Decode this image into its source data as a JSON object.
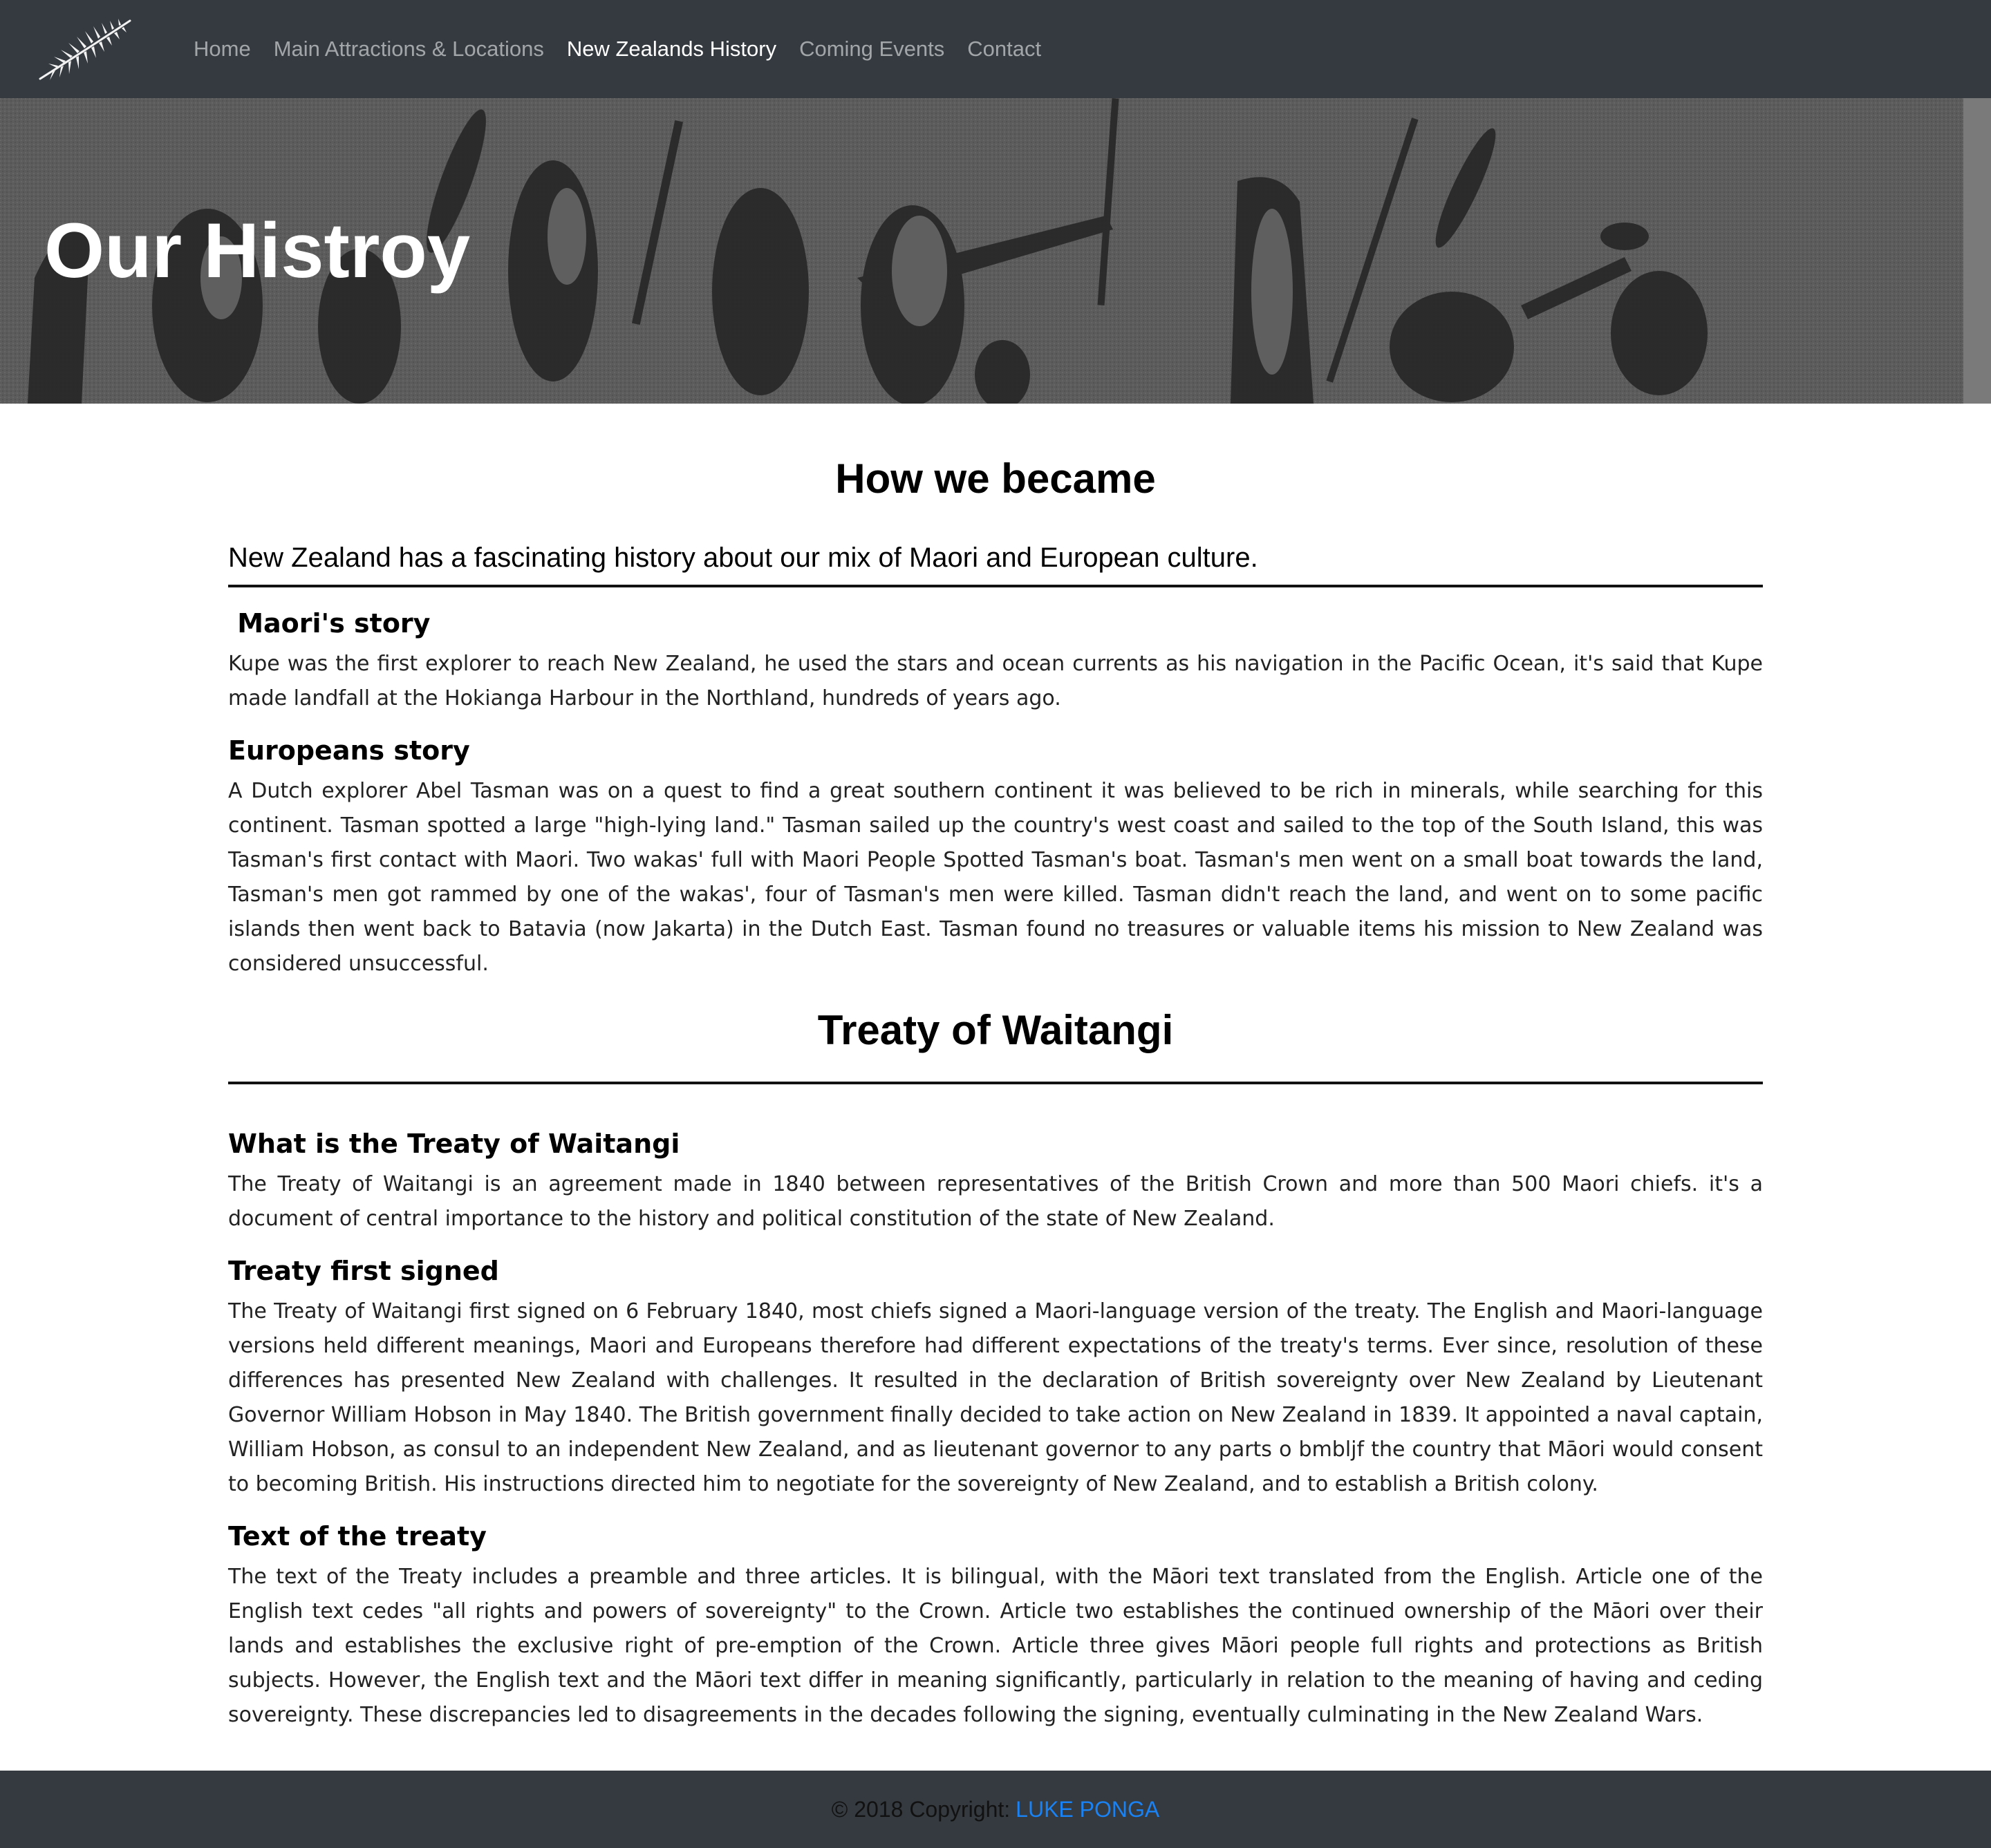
{
  "nav": {
    "brand_icon": "silver-fern-icon",
    "items": [
      {
        "label": "Home",
        "active": false
      },
      {
        "label": "Main Attractions & Locations",
        "active": false
      },
      {
        "label": "New Zealands History",
        "active": true
      },
      {
        "label": "Coming Events",
        "active": false
      },
      {
        "label": "Contact",
        "active": false
      }
    ]
  },
  "hero": {
    "title": "Our Histroy"
  },
  "intro": {
    "heading": "How we became",
    "lead": "New Zealand has a fascinating history about our mix of Maori and European culture."
  },
  "maori": {
    "heading": " Maori's story",
    "text": "Kupe was the first explorer to reach New Zealand, he used the stars and ocean currents as his navigation in the Pacific Ocean, it's said that Kupe made landfall at the Hokianga Harbour in the Northland, hundreds of years ago."
  },
  "europeans": {
    "heading": "Europeans story",
    "text": "A Dutch explorer Abel Tasman was on a quest to find a great southern continent it was believed to be rich in minerals, while searching for this continent. Tasman spotted a large \"high-lying land.\" Tasman sailed up the country's west coast and sailed to the top of the South Island, this was Tasman's first contact with Maori. Two wakas' full with Maori People Spotted Tasman's boat. Tasman's men went on a small boat towards the land, Tasman's men got rammed by one of the wakas', four of Tasman's men were killed. Tasman didn't reach the land, and went on to some pacific islands then went back to Batavia (now Jakarta) in the Dutch East. Tasman found no treasures or valuable items his mission to New Zealand was considered unsuccessful."
  },
  "treaty": {
    "heading": "Treaty of Waitangi",
    "what": {
      "heading": "What is the Treaty of Waitangi",
      "text": "The Treaty of Waitangi is an agreement made in 1840 between representatives of the British Crown and more than 500 Maori chiefs. it's a document of central importance to the history and political constitution of the state of New Zealand."
    },
    "first_signed": {
      "heading": "Treaty first signed",
      "text": "The Treaty of Waitangi first signed on 6 February 1840, most chiefs signed a Maori-language version of the treaty. The English and Maori-language versions held different meanings, Maori and Europeans therefore had different expectations of the treaty's terms. Ever since, resolution of these differences has presented New Zealand with challenges. It resulted in the declaration of British sovereignty over New Zealand by Lieutenant Governor William Hobson in May 1840. The British government finally decided to take action on New Zealand in 1839. It appointed a naval captain, William Hobson, as consul to an independent New Zealand, and as lieutenant governor to any parts o bmbljf the country that Māori would consent to becoming British. His instructions directed him to negotiate for the sovereignty of New Zealand, and to establish a British colony."
    },
    "text_of": {
      "heading": "Text of the treaty",
      "text": "The text of the Treaty includes a preamble and three articles. It is bilingual, with the Māori text translated from the English. Article one of the English text cedes \"all rights and powers of sovereignty\" to the Crown. Article two establishes the continued ownership of the Māori over their lands and establishes the exclusive right of pre-emption of the Crown. Article three gives Māori people full rights and protections as British subjects. However, the English text and the Māori text differ in meaning significantly, particularly in relation to the meaning of having and ceding sovereignty. These discrepancies led to disagreements in the decades following the signing, eventually culminating in the New Zealand Wars."
    }
  },
  "footer": {
    "copyright": "© 2018 Copyright:",
    "author": "LUKE PONGA",
    "link_color": "#1a82f2"
  }
}
